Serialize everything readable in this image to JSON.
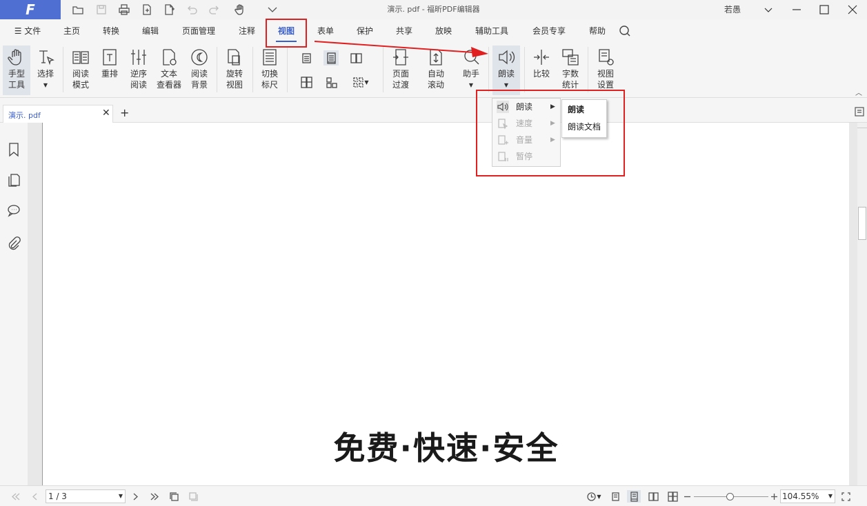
{
  "app": {
    "logo": "F",
    "window_title": "演示. pdf - 福昕PDF编辑器",
    "user": "若愚"
  },
  "menu": {
    "file": "文件",
    "items": [
      "主页",
      "转换",
      "编辑",
      "页面管理",
      "注释",
      "视图",
      "表单",
      "保护",
      "共享",
      "放映",
      "辅助工具",
      "会员专享",
      "帮助"
    ],
    "active": "视图"
  },
  "ribbon": {
    "hand_tool": [
      "手型",
      "工具"
    ],
    "select": "选择",
    "read_mode": [
      "阅读",
      "模式"
    ],
    "reflow": "重排",
    "reverse_read": [
      "逆序",
      "阅读"
    ],
    "text_viewer": [
      "文本",
      "查看器"
    ],
    "read_background": [
      "阅读",
      "背景"
    ],
    "rotate_view": [
      "旋转",
      "视图"
    ],
    "toggle_ruler": [
      "切换",
      "标尺"
    ],
    "page_transition": [
      "页面",
      "过渡"
    ],
    "auto_scroll": [
      "自动",
      "滚动"
    ],
    "assistant": "助手",
    "read_aloud": "朗读",
    "compare": "比较",
    "word_count": [
      "字数",
      "统计"
    ],
    "view_settings": [
      "视图",
      "设置"
    ]
  },
  "dropdown": {
    "items": [
      {
        "label": "朗读",
        "icon": "speaker-icon",
        "enabled": true
      },
      {
        "label": "速度",
        "icon": "speed-icon",
        "enabled": false
      },
      {
        "label": "音量",
        "icon": "volume-icon",
        "enabled": false
      },
      {
        "label": "暂停",
        "icon": "pause-icon",
        "enabled": false
      }
    ],
    "submenu": [
      "朗读",
      "朗读文档"
    ]
  },
  "tabs": {
    "doc_title": "演示. pdf"
  },
  "document": {
    "headline": "免费·快速·安全"
  },
  "status": {
    "page": "1 / 3",
    "zoom": "104.55%",
    "zoom_level": 0.45
  },
  "colors": {
    "accent": "#3b5fc8",
    "logo_bg": "#4f6fd3",
    "highlight": "#e02020"
  }
}
